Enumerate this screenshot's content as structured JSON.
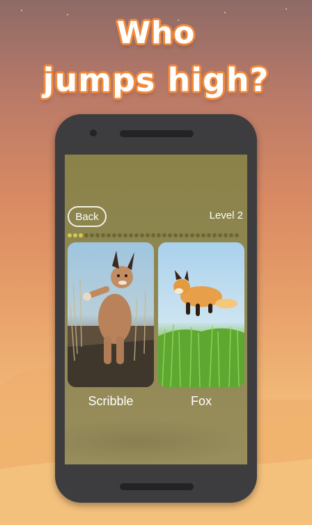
{
  "headline": {
    "line1": "Who",
    "line2": "jumps high?"
  },
  "screen": {
    "back_label": "Back",
    "level_label": "Level 2",
    "progress": {
      "completed": 3,
      "total": 31
    },
    "options": [
      {
        "label": "Scribble",
        "image": "caracal-photo"
      },
      {
        "label": "Fox",
        "image": "fox-photo"
      }
    ]
  },
  "colors": {
    "headline_outline": "#f08a3c",
    "screen_bg": "#8f8752",
    "progress_active": "#d8c94a",
    "progress_inactive": "#6e6634"
  }
}
